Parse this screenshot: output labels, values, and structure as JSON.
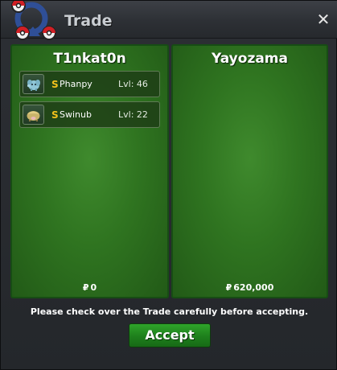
{
  "window": {
    "title": "Trade",
    "close_icon": "close-icon"
  },
  "left_trader": {
    "name": "T1nkat0n",
    "money_symbol": "₽",
    "money": "0",
    "pokemon": [
      {
        "shiny_mark": "S",
        "name": "Phanpy",
        "level": "Lvl: 46",
        "icon": "phanpy-icon"
      },
      {
        "shiny_mark": "S",
        "name": "Swinub",
        "level": "Lvl: 22",
        "icon": "swinub-icon"
      }
    ]
  },
  "right_trader": {
    "name": "Yayozama",
    "money_symbol": "₽",
    "money": "620,000",
    "pokemon": []
  },
  "notice": "Please check over the Trade carefully before accepting.",
  "accept_label": "Accept",
  "colors": {
    "panel_green": "#2f7420",
    "accept_green": "#1e7f1c",
    "shiny_gold": "#f3c21c"
  }
}
